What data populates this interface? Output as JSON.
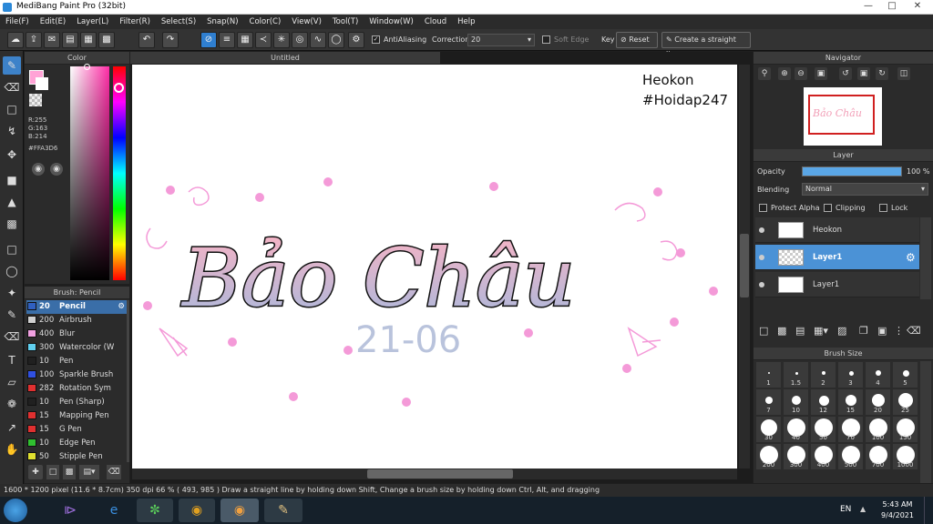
{
  "window": {
    "title": "MediBang Paint Pro (32bit)"
  },
  "menu": [
    "File(F)",
    "Edit(E)",
    "Layer(L)",
    "Filter(R)",
    "Select(S)",
    "Snap(N)",
    "Color(C)",
    "View(V)",
    "Tool(T)",
    "Window(W)",
    "Cloud",
    "Help"
  ],
  "toolbar": {
    "antialiasing_label": "AntiAliasing",
    "correction_label": "Correction",
    "correction_value": "20",
    "soft_edge_label": "Soft Edge",
    "key_label": "Key",
    "reset_label": "Reset",
    "straight_line_label": "Create a straight line"
  },
  "color_panel": {
    "title": "Color",
    "r": "R:255",
    "g": "G:163",
    "b": "B:214",
    "hex": "#FFA3D6",
    "fg_color": "#FFA3D6",
    "bg_color": "#FFFFFF"
  },
  "brush_panel": {
    "title": "Brush: Pencil",
    "items": [
      {
        "size": "20",
        "name": "Pencil",
        "color": "#3060c0"
      },
      {
        "size": "200",
        "name": "Airbrush",
        "color": "#d0d0d0"
      },
      {
        "size": "400",
        "name": "Blur",
        "color": "#f0a0e0"
      },
      {
        "size": "300",
        "name": "Watercolor (W",
        "color": "#60d0f0"
      },
      {
        "size": "10",
        "name": "Pen",
        "color": "#202020"
      },
      {
        "size": "100",
        "name": "Sparkle Brush",
        "color": "#3050e0"
      },
      {
        "size": "282",
        "name": "Rotation Sym",
        "color": "#e03030"
      },
      {
        "size": "10",
        "name": "Pen (Sharp)",
        "color": "#202020"
      },
      {
        "size": "15",
        "name": "Mapping Pen",
        "color": "#e03030"
      },
      {
        "size": "15",
        "name": "G Pen",
        "color": "#e03030"
      },
      {
        "size": "10",
        "name": "Edge Pen",
        "color": "#30c030"
      },
      {
        "size": "50",
        "name": "Stipple Pen",
        "color": "#e0e030"
      }
    ]
  },
  "document": {
    "tab": "Untitled",
    "watermark_line1": "Heokon",
    "watermark_line2": "#Hoidap247",
    "art_text": "Bảo Châu",
    "art_date": "21-06"
  },
  "navigator": {
    "title": "Navigator",
    "thumb_text": "Bảo Châu"
  },
  "layer_panel": {
    "title": "Layer",
    "opacity_label": "Opacity",
    "opacity_value": "100 %",
    "opacity_fraction": 1.0,
    "blending_label": "Blending",
    "blending_value": "Normal",
    "protect_alpha_label": "Protect Alpha",
    "clipping_label": "Clipping",
    "lock_label": "Lock",
    "layers": [
      {
        "name": "Heokon"
      },
      {
        "name": "Layer1"
      },
      {
        "name": "Layer1"
      }
    ]
  },
  "brush_size_panel": {
    "title": "Brush Size",
    "sizes": [
      "1",
      "1.5",
      "2",
      "3",
      "4",
      "5",
      "7",
      "10",
      "12",
      "15",
      "20",
      "25",
      "30",
      "40",
      "50",
      "70",
      "100",
      "150",
      "200",
      "300",
      "400",
      "500",
      "700",
      "1000"
    ]
  },
  "status": {
    "text": "1600 * 1200 pixel   (11.6 * 8.7cm)   350 dpi   66 %   ( 493, 985 )   Draw a straight line by holding down Shift, Change a brush size by holding down Ctrl, Alt, and dragging"
  },
  "taskbar": {
    "lang": "EN",
    "time": "5:43 AM",
    "date": "9/4/2021"
  }
}
